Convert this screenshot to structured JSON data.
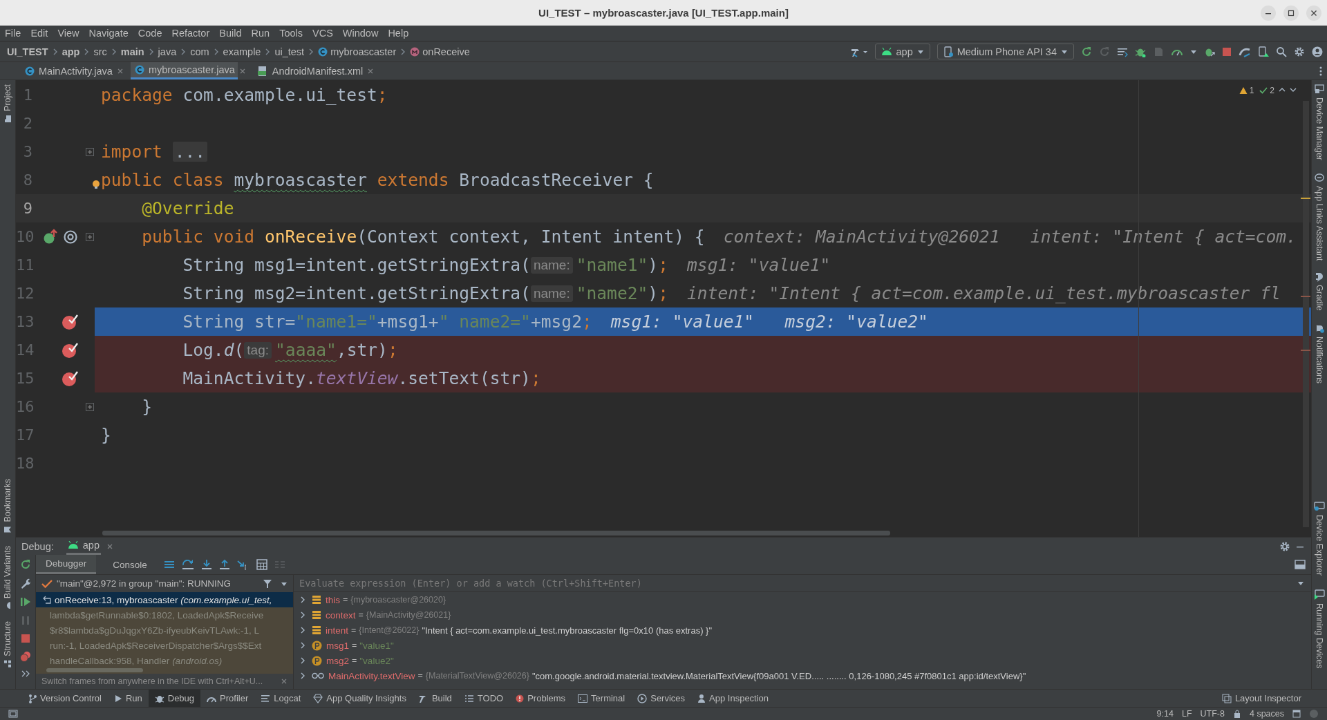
{
  "window": {
    "title": "UI_TEST – mybroascaster.java [UI_TEST.app.main]"
  },
  "menu": [
    "File",
    "Edit",
    "View",
    "Navigate",
    "Code",
    "Refactor",
    "Build",
    "Run",
    "Tools",
    "VCS",
    "Window",
    "Help"
  ],
  "breadcrumbs": [
    {
      "label": "UI_TEST",
      "bold": true,
      "kind": "folder"
    },
    {
      "label": "app",
      "bold": true,
      "kind": "folder"
    },
    {
      "label": "src",
      "bold": false,
      "kind": "folder"
    },
    {
      "label": "main",
      "bold": true,
      "kind": "folder"
    },
    {
      "label": "java",
      "bold": false,
      "kind": "folder"
    },
    {
      "label": "com",
      "bold": false,
      "kind": "folder"
    },
    {
      "label": "example",
      "bold": false,
      "kind": "folder"
    },
    {
      "label": "ui_test",
      "bold": false,
      "kind": "folder"
    },
    {
      "label": "mybroascaster",
      "bold": false,
      "kind": "class"
    },
    {
      "label": "onReceive",
      "bold": false,
      "kind": "method"
    }
  ],
  "toolbar": {
    "run_config": "app",
    "device": "Medium Phone API 34"
  },
  "tabs": [
    {
      "label": "MainActivity.java",
      "kind": "class",
      "selected": false
    },
    {
      "label": "mybroascaster.java",
      "kind": "class",
      "selected": true
    },
    {
      "label": "AndroidManifest.xml",
      "kind": "manifest",
      "selected": false
    }
  ],
  "left_strip": {
    "top": [
      "Project"
    ],
    "bottom": [
      "Bookmarks",
      "Build Variants",
      "Structure"
    ]
  },
  "right_strip": {
    "top": [
      "Device Manager",
      "App Links Assistant",
      "Gradle",
      "Notifications"
    ],
    "bottom": [
      "Device Explorer",
      "Running Devices"
    ]
  },
  "inspections": {
    "warnings": "1",
    "weak_warnings": "2"
  },
  "editor": {
    "lines": [
      {
        "number": "1",
        "current": false,
        "caret": false,
        "breakpoint": false,
        "overrides": false,
        "bulb": false,
        "foldable": false,
        "tokens": [
          {
            "kind": "kw",
            "text": "package"
          },
          {
            "kind": "plain",
            "text": " com.example.ui_test"
          },
          {
            "kind": "kw",
            "text": ";"
          }
        ]
      },
      {
        "number": "2",
        "current": false,
        "caret": false,
        "breakpoint": false,
        "overrides": false,
        "bulb": false,
        "foldable": false
      },
      {
        "number": "3",
        "current": false,
        "caret": false,
        "breakpoint": false,
        "overrides": false,
        "bulb": false,
        "foldable": true,
        "tokens": [
          {
            "kind": "kw",
            "text": "import "
          },
          {
            "kind": "folded",
            "text": "..."
          }
        ]
      },
      {
        "number": "8",
        "current": false,
        "caret": false,
        "breakpoint": false,
        "overrides": false,
        "bulb": true,
        "foldable": false,
        "tokens": [
          {
            "kind": "kw",
            "text": "public class "
          },
          {
            "kind": "squiggle",
            "text": "mybroascaster"
          },
          {
            "kind": "kw",
            "text": " extends"
          },
          {
            "kind": "plain",
            "text": " BroadcastReceiver {"
          }
        ]
      },
      {
        "number": "9",
        "current": false,
        "caret": true,
        "breakpoint": false,
        "overrides": false,
        "bulb": false,
        "foldable": false,
        "tokens": [
          {
            "kind": "ann",
            "text": "    @Override"
          }
        ]
      },
      {
        "number": "10",
        "current": false,
        "caret": false,
        "breakpoint": false,
        "overrides": true,
        "bulb": false,
        "foldable": true,
        "tokens": [
          {
            "kind": "kw",
            "text": "    public void "
          },
          {
            "kind": "fn",
            "text": "onReceive"
          },
          {
            "kind": "plain",
            "text": "(Context context, Intent intent) {"
          },
          {
            "kind": "debug",
            "text": "context: MainActivity@26021   intent: \"Intent { act=com."
          }
        ]
      },
      {
        "number": "11",
        "current": false,
        "caret": false,
        "breakpoint": false,
        "overrides": false,
        "bulb": false,
        "foldable": false,
        "tokens": [
          {
            "kind": "plain",
            "text": "        String msg1=intent.getStringExtra("
          },
          {
            "kind": "hint",
            "text": "name:"
          },
          {
            "kind": "str",
            "text": "\"name1\""
          },
          {
            "kind": "plain",
            "text": ")"
          },
          {
            "kind": "kw",
            "text": ";"
          },
          {
            "kind": "debug",
            "text": "msg1: \"value1\""
          }
        ]
      },
      {
        "number": "12",
        "current": false,
        "caret": false,
        "breakpoint": false,
        "overrides": false,
        "bulb": false,
        "foldable": false,
        "tokens": [
          {
            "kind": "plain",
            "text": "        String msg2=intent.getStringExtra("
          },
          {
            "kind": "hint",
            "text": "name:"
          },
          {
            "kind": "str",
            "text": "\"name2\""
          },
          {
            "kind": "plain",
            "text": ")"
          },
          {
            "kind": "kw",
            "text": ";"
          },
          {
            "kind": "debug",
            "text": "intent: \"Intent { act=com.example.ui_test.mybroascaster fl"
          }
        ]
      },
      {
        "number": "13",
        "current": true,
        "caret": false,
        "breakpoint": true,
        "overrides": false,
        "bulb": false,
        "foldable": false,
        "tokens": [
          {
            "kind": "plain",
            "text": "        String str="
          },
          {
            "kind": "str",
            "text": "\"name1=\""
          },
          {
            "kind": "plain",
            "text": "+msg1+"
          },
          {
            "kind": "str",
            "text": "\" name2=\""
          },
          {
            "kind": "plain",
            "text": "+msg2"
          },
          {
            "kind": "kw",
            "text": ";"
          },
          {
            "kind": "debug",
            "text": "msg1: \"value1\"   msg2: \"value2\""
          }
        ]
      },
      {
        "number": "14",
        "current": false,
        "caret": false,
        "breakpoint": true,
        "overrides": false,
        "bulb": false,
        "foldable": false,
        "tokens": [
          {
            "kind": "plain",
            "text": "        Log."
          },
          {
            "kind": "static_call",
            "text": "d"
          },
          {
            "kind": "plain",
            "text": "("
          },
          {
            "kind": "hint",
            "text": "tag:"
          },
          {
            "kind": "str_squiggle",
            "text": "\"aaaa\""
          },
          {
            "kind": "plain",
            "text": ",str)"
          },
          {
            "kind": "kw",
            "text": ";"
          }
        ]
      },
      {
        "number": "15",
        "current": false,
        "caret": false,
        "breakpoint": true,
        "overrides": false,
        "bulb": false,
        "foldable": false,
        "tokens": [
          {
            "kind": "plain",
            "text": "        MainActivity."
          },
          {
            "kind": "static",
            "text": "textView"
          },
          {
            "kind": "plain",
            "text": ".setText(str)"
          },
          {
            "kind": "kw",
            "text": ";"
          }
        ]
      },
      {
        "number": "16",
        "current": false,
        "caret": false,
        "breakpoint": false,
        "overrides": false,
        "bulb": false,
        "foldable": true,
        "tokens": [
          {
            "kind": "plain",
            "text": "    }"
          }
        ]
      },
      {
        "number": "17",
        "current": false,
        "caret": false,
        "breakpoint": false,
        "overrides": false,
        "bulb": false,
        "foldable": false,
        "tokens": [
          {
            "kind": "plain",
            "text": "}"
          }
        ]
      },
      {
        "number": "18",
        "current": false,
        "caret": false,
        "breakpoint": false,
        "overrides": false,
        "bulb": false,
        "foldable": false
      }
    ]
  },
  "debug": {
    "title": "Debug:",
    "session": "app",
    "tabs": [
      {
        "label": "Debugger",
        "selected": true
      },
      {
        "label": "Console",
        "selected": false
      }
    ],
    "thread": "\"main\"@2,972 in group \"main\": RUNNING",
    "frames": [
      {
        "text": "onReceive:13, mybroascaster *(com.example.ui_test,*",
        "selected": true,
        "library": false
      },
      {
        "text": "lambda$getRunnable$0:1802, LoadedApk$Receive",
        "selected": false,
        "library": true
      },
      {
        "text": "$r8$lambda$gDuJqgxY6Zb-ifyeubKeivTLAwk:-1, L",
        "selected": false,
        "library": true
      },
      {
        "text": "run:-1, LoadedApk$ReceiverDispatcher$Args$$Ext",
        "selected": false,
        "library": true
      },
      {
        "text": "handleCallback:958, Handler *(android.os)*",
        "selected": false,
        "library": true
      }
    ],
    "notice": "Switch frames from anywhere in the IDE with Ctrl+Alt+U...",
    "evaluate": {
      "placeholder": "Evaluate expression (Enter) or add a watch (Ctrl+Shift+Enter)"
    },
    "variables": [
      {
        "kind": "field",
        "name": "this",
        "sep": "=",
        "type": "{mybroascaster@26020}"
      },
      {
        "kind": "field",
        "name": "context",
        "sep": "=",
        "type": "{MainActivity@26021}"
      },
      {
        "kind": "field",
        "name": "intent",
        "sep": "=",
        "type": "{Intent@26022}",
        "value": "\"Intent { act=com.example.ui_test.mybroascaster flg=0x10 (has extras) }\"",
        "string_value": false
      },
      {
        "kind": "param",
        "name": "msg1",
        "sep": "=",
        "value": "\"value1\"",
        "string_value": true
      },
      {
        "kind": "param",
        "name": "msg2",
        "sep": "=",
        "value": "\"value2\"",
        "string_value": true
      },
      {
        "kind": "watch",
        "name": "MainActivity.textView",
        "sep": "=",
        "type": "{MaterialTextView@26026}",
        "value": "\"com.google.android.material.textview.MaterialTextView{f09a001 V.ED..... ........ 0,126-1080,245 #7f0801c1 app:id/textView}\"",
        "string_value": false
      }
    ]
  },
  "tool_windows": [
    {
      "label": "Version Control",
      "kind": "vcs",
      "selected": false
    },
    {
      "label": "Run",
      "kind": "run",
      "selected": false
    },
    {
      "label": "Debug",
      "kind": "debug",
      "selected": true
    },
    {
      "label": "Profiler",
      "kind": "profiler",
      "selected": false
    },
    {
      "label": "Logcat",
      "kind": "logcat",
      "selected": false
    },
    {
      "label": "App Quality Insights",
      "kind": "insights",
      "selected": false
    },
    {
      "label": "Build",
      "kind": "build",
      "selected": false
    },
    {
      "label": "TODO",
      "kind": "todo",
      "selected": false
    },
    {
      "label": "Problems",
      "kind": "problems",
      "selected": false
    },
    {
      "label": "Terminal",
      "kind": "terminal",
      "selected": false
    },
    {
      "label": "Services",
      "kind": "services",
      "selected": false
    },
    {
      "label": "App Inspection",
      "kind": "inspection",
      "selected": false
    }
  ],
  "layout_inspector": "Layout Inspector",
  "status": [
    "9:14",
    "LF",
    "UTF-8",
    "4 spaces"
  ]
}
